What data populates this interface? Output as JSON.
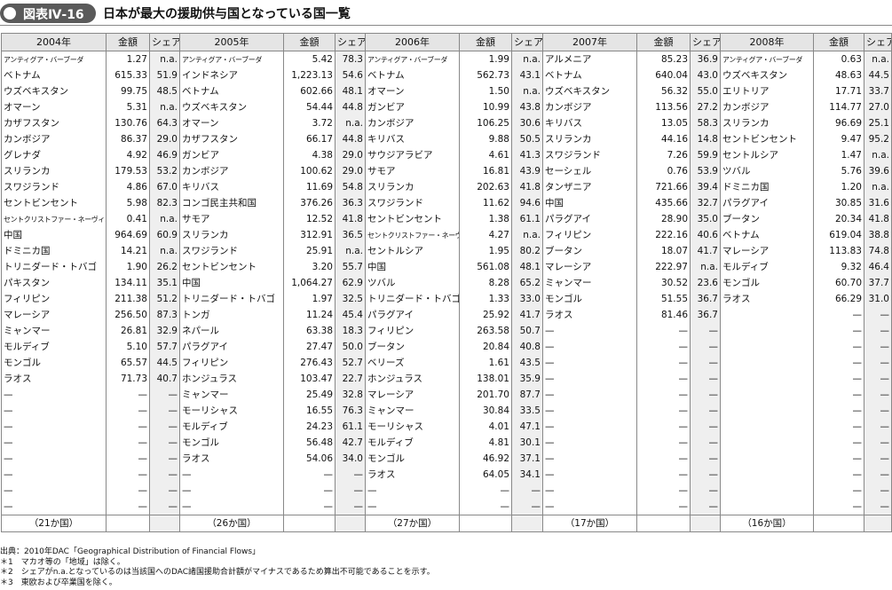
{
  "header": {
    "badge": "図表Ⅳ-16",
    "title": "日本が最大の援助供与国となっている国一覧"
  },
  "table": {
    "col_headers": [
      "2004年",
      "金額",
      "シェア",
      "2005年",
      "金額",
      "シェア",
      "2006年",
      "金額",
      "シェア",
      "2007年",
      "金額",
      "シェア",
      "2008年",
      "金額",
      "シェア"
    ],
    "rows": [
      [
        "アンティグア・バーブーダ",
        "1.27",
        "n.a.",
        "アンティグア・バーブーダ",
        "5.42",
        "78.3",
        "アンティグア・バーブーダ",
        "1.99",
        "n.a.",
        "アルメニア",
        "85.23",
        "36.9",
        "アンティグア・バーブーダ",
        "0.63",
        "n.a."
      ],
      [
        "ベトナム",
        "615.33",
        "51.9",
        "インドネシア",
        "1,223.13",
        "54.6",
        "ベトナム",
        "562.73",
        "43.1",
        "ベトナム",
        "640.04",
        "43.0",
        "ウズベキスタン",
        "48.63",
        "44.5"
      ],
      [
        "ウズベキスタン",
        "99.75",
        "48.5",
        "ベトナム",
        "602.66",
        "48.1",
        "オマーン",
        "1.50",
        "n.a.",
        "ウズベキスタン",
        "56.32",
        "55.0",
        "エリトリア",
        "17.71",
        "33.7"
      ],
      [
        "オマーン",
        "5.31",
        "n.a.",
        "ウズベキスタン",
        "54.44",
        "44.8",
        "ガンビア",
        "10.99",
        "43.8",
        "カンボジア",
        "113.56",
        "27.2",
        "カンボジア",
        "114.77",
        "27.0"
      ],
      [
        "カザフスタン",
        "130.76",
        "64.3",
        "オマーン",
        "3.72",
        "n.a.",
        "カンボジア",
        "106.25",
        "30.6",
        "キリバス",
        "13.05",
        "58.3",
        "スリランカ",
        "96.69",
        "25.1"
      ],
      [
        "カンボジア",
        "86.37",
        "29.0",
        "カザフスタン",
        "66.17",
        "44.8",
        "キリバス",
        "9.88",
        "50.5",
        "スリランカ",
        "44.16",
        "14.8",
        "セントビンセント",
        "9.47",
        "95.2"
      ],
      [
        "グレナダ",
        "4.92",
        "46.9",
        "ガンビア",
        "4.38",
        "29.0",
        "サウジアラビア",
        "4.61",
        "41.3",
        "スワジランド",
        "7.26",
        "59.9",
        "セントルシア",
        "1.47",
        "n.a."
      ],
      [
        "スリランカ",
        "179.53",
        "53.2",
        "カンボジア",
        "100.62",
        "29.0",
        "サモア",
        "16.81",
        "43.9",
        "セーシェル",
        "0.76",
        "53.9",
        "ツバル",
        "5.76",
        "39.6"
      ],
      [
        "スワジランド",
        "4.86",
        "67.0",
        "キリバス",
        "11.69",
        "54.8",
        "スリランカ",
        "202.63",
        "41.8",
        "タンザニア",
        "721.66",
        "39.4",
        "ドミニカ国",
        "1.20",
        "n.a."
      ],
      [
        "セントビンセント",
        "5.98",
        "82.3",
        "コンゴ民主共和国",
        "376.26",
        "36.3",
        "スワジランド",
        "11.62",
        "94.6",
        "中国",
        "435.66",
        "32.7",
        "パラグアイ",
        "30.85",
        "31.6"
      ],
      [
        "セントクリストファー・ネーヴィス",
        "0.41",
        "n.a.",
        "サモア",
        "12.52",
        "41.8",
        "セントビンセント",
        "1.38",
        "61.1",
        "パラグアイ",
        "28.90",
        "35.0",
        "ブータン",
        "20.34",
        "41.8"
      ],
      [
        "中国",
        "964.69",
        "60.9",
        "スリランカ",
        "312.91",
        "36.5",
        "セントクリストファー・ネーヴィス",
        "4.27",
        "n.a.",
        "フィリピン",
        "222.16",
        "40.6",
        "ベトナム",
        "619.04",
        "38.8"
      ],
      [
        "ドミニカ国",
        "14.21",
        "n.a.",
        "スワジランド",
        "25.91",
        "n.a.",
        "セントルシア",
        "1.95",
        "80.2",
        "ブータン",
        "18.07",
        "41.7",
        "マレーシア",
        "113.83",
        "74.8"
      ],
      [
        "トリニダード・トバゴ",
        "1.90",
        "26.2",
        "セントビンセント",
        "3.20",
        "55.7",
        "中国",
        "561.08",
        "48.1",
        "マレーシア",
        "222.97",
        "n.a.",
        "モルディブ",
        "9.32",
        "46.4"
      ],
      [
        "パキスタン",
        "134.11",
        "35.1",
        "中国",
        "1,064.27",
        "62.9",
        "ツバル",
        "8.28",
        "65.2",
        "ミャンマー",
        "30.52",
        "23.6",
        "モンゴル",
        "60.70",
        "37.7"
      ],
      [
        "フィリピン",
        "211.38",
        "51.2",
        "トリニダード・トバゴ",
        "1.97",
        "32.5",
        "トリニダード・トバゴ",
        "1.33",
        "33.0",
        "モンゴル",
        "51.55",
        "36.7",
        "ラオス",
        "66.29",
        "31.0"
      ],
      [
        "マレーシア",
        "256.50",
        "87.3",
        "トンガ",
        "11.24",
        "45.4",
        "パラグアイ",
        "25.92",
        "41.7",
        "ラオス",
        "81.46",
        "36.7",
        "",
        "—",
        "—"
      ],
      [
        "ミャンマー",
        "26.81",
        "32.9",
        "ネパール",
        "63.38",
        "18.3",
        "フィリピン",
        "263.58",
        "50.7",
        "—",
        "—",
        "—",
        "",
        "—",
        "—"
      ],
      [
        "モルディブ",
        "5.10",
        "57.7",
        "パラグアイ",
        "27.47",
        "50.0",
        "ブータン",
        "20.84",
        "40.8",
        "—",
        "—",
        "—",
        "",
        "—",
        "—"
      ],
      [
        "モンゴル",
        "65.57",
        "44.5",
        "フィリピン",
        "276.43",
        "52.7",
        "ベリーズ",
        "1.61",
        "43.5",
        "—",
        "—",
        "—",
        "",
        "—",
        "—"
      ],
      [
        "ラオス",
        "71.73",
        "40.7",
        "ホンジュラス",
        "103.47",
        "22.7",
        "ホンジュラス",
        "138.01",
        "35.9",
        "—",
        "—",
        "—",
        "",
        "—",
        "—"
      ],
      [
        "—",
        "—",
        "—",
        "ミャンマー",
        "25.49",
        "32.8",
        "マレーシア",
        "201.70",
        "87.7",
        "—",
        "—",
        "—",
        "",
        "—",
        "—"
      ],
      [
        "—",
        "—",
        "—",
        "モーリシャス",
        "16.55",
        "76.3",
        "ミャンマー",
        "30.84",
        "33.5",
        "—",
        "—",
        "—",
        "",
        "—",
        "—"
      ],
      [
        "—",
        "—",
        "—",
        "モルディブ",
        "24.23",
        "61.1",
        "モーリシャス",
        "4.01",
        "47.1",
        "—",
        "—",
        "—",
        "",
        "—",
        "—"
      ],
      [
        "—",
        "—",
        "—",
        "モンゴル",
        "56.48",
        "42.7",
        "モルディブ",
        "4.81",
        "30.1",
        "—",
        "—",
        "—",
        "",
        "—",
        "—"
      ],
      [
        "—",
        "—",
        "—",
        "ラオス",
        "54.06",
        "34.0",
        "モンゴル",
        "46.92",
        "37.1",
        "—",
        "—",
        "—",
        "",
        "—",
        "—"
      ],
      [
        "—",
        "—",
        "—",
        "—",
        "—",
        "—",
        "ラオス",
        "64.05",
        "34.1",
        "—",
        "—",
        "—",
        "",
        "—",
        "—"
      ],
      [
        "—",
        "—",
        "—",
        "—",
        "—",
        "—",
        "—",
        "—",
        "—",
        "—",
        "—",
        "—",
        "",
        "—",
        "—"
      ],
      [
        "—",
        "—",
        "—",
        "—",
        "—",
        "—",
        "—",
        "—",
        "—",
        "—",
        "—",
        "—",
        "",
        "—",
        "—"
      ]
    ],
    "totals": [
      "（21か国）",
      "（26か国）",
      "（27か国）",
      "（17か国）",
      "（16か国）"
    ]
  },
  "notes": [
    "出典：2010年DAC「Geographical Distribution of Financial Flows」",
    "＊1　マカオ等の「地域」は除く。",
    "＊2　シェアがn.a.となっているのは当該国へのDAC諸国援助合計額がマイナスであるため算出不可能であることを示す。",
    "＊3　東欧および卒業国を除く。"
  ]
}
